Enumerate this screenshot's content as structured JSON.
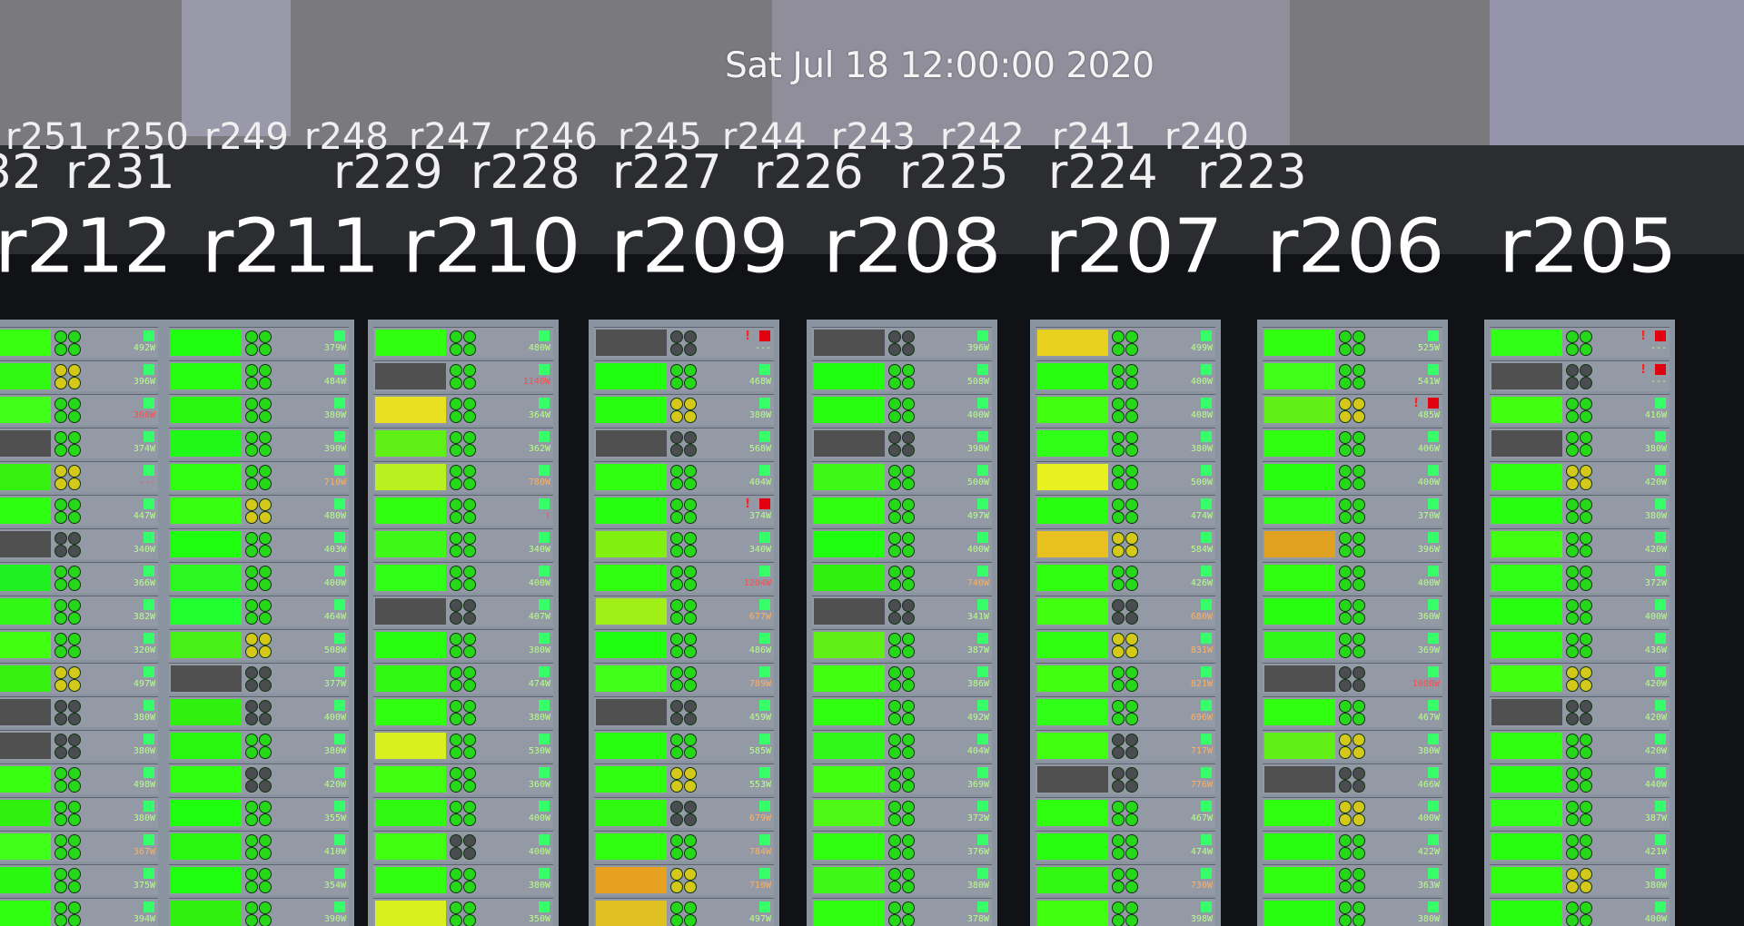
{
  "timestamp": "Sat Jul 18 12:00:00 2020",
  "far_row": [
    "r251",
    "r250",
    "r249",
    "r248",
    "r247",
    "r246",
    "r245",
    "r244",
    "r243",
    "r242",
    "r241",
    "r240"
  ],
  "mid_row": [
    "32",
    "r231",
    "r229",
    "r228",
    "r227",
    "r226",
    "r225",
    "r224",
    "r223"
  ],
  "near_row": [
    "r212",
    "r211",
    "r210",
    "r209",
    "r208",
    "r207",
    "r206",
    "r205"
  ],
  "colors": {
    "led_on": "#27d81a",
    "led_warn": "#d4c81a",
    "led_off": "#4a4c50",
    "alert": "#e00010"
  },
  "racks": [
    {
      "label": "r212",
      "nodes": [
        {
          "p": "492W",
          "h": "#38ff10",
          "s": "on"
        },
        {
          "p": "396W",
          "h": "#30f810",
          "s": "warn"
        },
        {
          "p": "300W",
          "h": "#40ff18",
          "s": "on",
          "c": "hot"
        },
        {
          "p": "374W",
          "h": "#505050",
          "s": "on"
        },
        {
          "p": "---",
          "h": "#36f010",
          "s": "warn",
          "c": "hot"
        },
        {
          "p": "447W",
          "h": "#2cff10",
          "s": "on"
        },
        {
          "p": "340W",
          "h": "#505050",
          "s": "off"
        },
        {
          "p": "366W",
          "h": "#20f020",
          "s": "on"
        },
        {
          "p": "382W",
          "h": "#30f814",
          "s": "on"
        },
        {
          "p": "320W",
          "h": "#40ff10",
          "s": "on"
        },
        {
          "p": "497W",
          "h": "#36f010",
          "s": "warn"
        },
        {
          "p": "380W",
          "h": "#505050",
          "s": "off"
        },
        {
          "p": "380W",
          "h": "#505050",
          "s": "off"
        },
        {
          "p": "498W",
          "h": "#38ff10",
          "s": "on"
        },
        {
          "p": "380W",
          "h": "#30f010",
          "s": "on"
        },
        {
          "p": "367W",
          "h": "#40ff18",
          "s": "on",
          "c": "warm"
        },
        {
          "p": "375W",
          "h": "#28f810",
          "s": "on"
        },
        {
          "p": "394W",
          "h": "#30ff10",
          "s": "on"
        }
      ]
    },
    {
      "label": "r211",
      "nodes": [
        {
          "p": "379W",
          "h": "#20ff10",
          "s": "on"
        },
        {
          "p": "484W",
          "h": "#26ff10",
          "s": "on"
        },
        {
          "p": "380W",
          "h": "#28f810",
          "s": "on"
        },
        {
          "p": "390W",
          "h": "#20f818",
          "s": "on"
        },
        {
          "p": "710W",
          "h": "#30ff10",
          "s": "on",
          "c": "warm"
        },
        {
          "p": "480W",
          "h": "#36ff10",
          "s": "warn"
        },
        {
          "p": "403W",
          "h": "#20ff10",
          "s": "on"
        },
        {
          "p": "400W",
          "h": "#2af820",
          "s": "on"
        },
        {
          "p": "464W",
          "h": "#20ff30",
          "s": "on"
        },
        {
          "p": "508W",
          "h": "#48f018",
          "s": "warn"
        },
        {
          "p": "377W",
          "h": "#505050",
          "s": "off"
        },
        {
          "p": "400W",
          "h": "#30f010",
          "s": "off"
        },
        {
          "p": "380W",
          "h": "#28f810",
          "s": "on"
        },
        {
          "p": "420W",
          "h": "#30ff10",
          "s": "off"
        },
        {
          "p": "355W",
          "h": "#20ff10",
          "s": "on"
        },
        {
          "p": "410W",
          "h": "#28f810",
          "s": "on"
        },
        {
          "p": "354W",
          "h": "#20ff10",
          "s": "on"
        },
        {
          "p": "390W",
          "h": "#30f010",
          "s": "on"
        }
      ]
    },
    {
      "label": "r210",
      "nodes": [
        {
          "p": "480W",
          "h": "#30ff10",
          "s": "on"
        },
        {
          "p": "1140W",
          "h": "#505050",
          "s": "on",
          "c": "hot"
        },
        {
          "p": "364W",
          "h": "#e8e020",
          "s": "on"
        },
        {
          "p": "362W",
          "h": "#60f018",
          "s": "on"
        },
        {
          "p": "780W",
          "h": "#b8f020",
          "s": "on",
          "c": "warm"
        },
        {
          "p": "!",
          "h": "#30ff10",
          "s": "on",
          "c": "hot"
        },
        {
          "p": "340W",
          "h": "#40f818",
          "s": "on"
        },
        {
          "p": "400W",
          "h": "#30ff18",
          "s": "on"
        },
        {
          "p": "407W",
          "h": "#505050",
          "s": "off"
        },
        {
          "p": "380W",
          "h": "#28ff10",
          "s": "on"
        },
        {
          "p": "474W",
          "h": "#30f810",
          "s": "on"
        },
        {
          "p": "380W",
          "h": "#30ff10",
          "s": "on"
        },
        {
          "p": "530W",
          "h": "#d8f020",
          "s": "on"
        },
        {
          "p": "360W",
          "h": "#40ff10",
          "s": "on"
        },
        {
          "p": "400W",
          "h": "#30f810",
          "s": "on"
        },
        {
          "p": "400W",
          "h": "#40ff10",
          "s": "off"
        },
        {
          "p": "380W",
          "h": "#30ff10",
          "s": "on"
        },
        {
          "p": "350W",
          "h": "#d8f020",
          "s": "on"
        }
      ]
    },
    {
      "label": "r209",
      "nodes": [
        {
          "p": "---",
          "h": "#505050",
          "s": "off",
          "alert": true
        },
        {
          "p": "468W",
          "h": "#20ff10",
          "s": "on"
        },
        {
          "p": "380W",
          "h": "#28ff10",
          "s": "warn"
        },
        {
          "p": "568W",
          "h": "#505050",
          "s": "off"
        },
        {
          "p": "404W",
          "h": "#30ff10",
          "s": "on"
        },
        {
          "p": "374W",
          "h": "#26ff10",
          "s": "on",
          "alert": true
        },
        {
          "p": "340W",
          "h": "#80f010",
          "s": "on"
        },
        {
          "p": "1204W",
          "h": "#30ff10",
          "s": "on",
          "c": "hot"
        },
        {
          "p": "677W",
          "h": "#a0f018",
          "s": "on",
          "c": "warm"
        },
        {
          "p": "486W",
          "h": "#20ff10",
          "s": "on"
        },
        {
          "p": "789W",
          "h": "#40ff18",
          "s": "on",
          "c": "warm"
        },
        {
          "p": "459W",
          "h": "#505050",
          "s": "off"
        },
        {
          "p": "585W",
          "h": "#28ff10",
          "s": "on"
        },
        {
          "p": "553W",
          "h": "#30ff10",
          "s": "warn"
        },
        {
          "p": "679W",
          "h": "#30f810",
          "s": "off",
          "c": "warm"
        },
        {
          "p": "784W",
          "h": "#30ff10",
          "s": "on",
          "c": "warm"
        },
        {
          "p": "710W",
          "h": "#e8a020",
          "s": "warn",
          "c": "warm"
        },
        {
          "p": "497W",
          "h": "#e0c020",
          "s": "on"
        }
      ]
    },
    {
      "label": "r208",
      "nodes": [
        {
          "p": "396W",
          "h": "#505050",
          "s": "off"
        },
        {
          "p": "508W",
          "h": "#20ff10",
          "s": "on"
        },
        {
          "p": "400W",
          "h": "#28ff10",
          "s": "on"
        },
        {
          "p": "398W",
          "h": "#505050",
          "s": "off"
        },
        {
          "p": "500W",
          "h": "#40f818",
          "s": "on"
        },
        {
          "p": "497W",
          "h": "#30ff10",
          "s": "on"
        },
        {
          "p": "400W",
          "h": "#20ff10",
          "s": "on"
        },
        {
          "p": "740W",
          "h": "#30f010",
          "s": "on",
          "c": "warm"
        },
        {
          "p": "341W",
          "h": "#505050",
          "s": "off"
        },
        {
          "p": "387W",
          "h": "#60f018",
          "s": "on"
        },
        {
          "p": "386W",
          "h": "#40ff10",
          "s": "on"
        },
        {
          "p": "492W",
          "h": "#30ff10",
          "s": "on"
        },
        {
          "p": "404W",
          "h": "#30f818",
          "s": "on"
        },
        {
          "p": "369W",
          "h": "#40ff10",
          "s": "on"
        },
        {
          "p": "372W",
          "h": "#50f818",
          "s": "on"
        },
        {
          "p": "376W",
          "h": "#30ff10",
          "s": "on"
        },
        {
          "p": "380W",
          "h": "#40f818",
          "s": "on"
        },
        {
          "p": "378W",
          "h": "#30ff10",
          "s": "on"
        }
      ]
    },
    {
      "label": "r207",
      "nodes": [
        {
          "p": "499W",
          "h": "#e8d020",
          "s": "on"
        },
        {
          "p": "400W",
          "h": "#28ff10",
          "s": "on"
        },
        {
          "p": "408W",
          "h": "#40ff10",
          "s": "on"
        },
        {
          "p": "380W",
          "h": "#30ff18",
          "s": "on"
        },
        {
          "p": "500W",
          "h": "#e8f020",
          "s": "on"
        },
        {
          "p": "474W",
          "h": "#28ff10",
          "s": "on"
        },
        {
          "p": "584W",
          "h": "#e8c020",
          "s": "warn"
        },
        {
          "p": "426W",
          "h": "#30ff10",
          "s": "on"
        },
        {
          "p": "680W",
          "h": "#40ff10",
          "s": "off",
          "c": "warm"
        },
        {
          "p": "831W",
          "h": "#30ff10",
          "s": "warn",
          "c": "warm"
        },
        {
          "p": "821W",
          "h": "#40ff10",
          "s": "on",
          "c": "warm"
        },
        {
          "p": "696W",
          "h": "#30ff18",
          "s": "on",
          "c": "warm"
        },
        {
          "p": "717W",
          "h": "#40ff10",
          "s": "off",
          "c": "warm"
        },
        {
          "p": "776W",
          "h": "#505050",
          "s": "off",
          "c": "warm"
        },
        {
          "p": "467W",
          "h": "#30ff10",
          "s": "on"
        },
        {
          "p": "474W",
          "h": "#28ff10",
          "s": "on"
        },
        {
          "p": "730W",
          "h": "#30f810",
          "s": "on",
          "c": "warm"
        },
        {
          "p": "398W",
          "h": "#40ff10",
          "s": "on"
        }
      ]
    },
    {
      "label": "r206",
      "nodes": [
        {
          "p": "525W",
          "h": "#30ff10",
          "s": "on"
        },
        {
          "p": "541W",
          "h": "#40ff18",
          "s": "on"
        },
        {
          "p": "485W",
          "h": "#60f018",
          "s": "warn",
          "alert": true
        },
        {
          "p": "406W",
          "h": "#30ff10",
          "s": "on"
        },
        {
          "p": "400W",
          "h": "#28ff10",
          "s": "on"
        },
        {
          "p": "370W",
          "h": "#30ff18",
          "s": "on"
        },
        {
          "p": "396W",
          "h": "#e0a020",
          "s": "on"
        },
        {
          "p": "400W",
          "h": "#30ff10",
          "s": "on"
        },
        {
          "p": "360W",
          "h": "#28ff10",
          "s": "on"
        },
        {
          "p": "369W",
          "h": "#30f818",
          "s": "on"
        },
        {
          "p": "1000W",
          "h": "#505050",
          "s": "off",
          "c": "hot"
        },
        {
          "p": "467W",
          "h": "#30ff10",
          "s": "on"
        },
        {
          "p": "380W",
          "h": "#60f018",
          "s": "warn"
        },
        {
          "p": "466W",
          "h": "#505050",
          "s": "off"
        },
        {
          "p": "400W",
          "h": "#30ff10",
          "s": "warn"
        },
        {
          "p": "422W",
          "h": "#28ff10",
          "s": "on"
        },
        {
          "p": "363W",
          "h": "#30ff10",
          "s": "on"
        },
        {
          "p": "380W",
          "h": "#28ff10",
          "s": "on"
        }
      ]
    },
    {
      "label": "r205",
      "nodes": [
        {
          "p": "---",
          "h": "#30ff18",
          "s": "on",
          "alert": true
        },
        {
          "p": "---",
          "h": "#505050",
          "s": "off",
          "alert": true
        },
        {
          "p": "416W",
          "h": "#40ff10",
          "s": "on"
        },
        {
          "p": "380W",
          "h": "#505050",
          "s": "on"
        },
        {
          "p": "420W",
          "h": "#30ff10",
          "s": "warn"
        },
        {
          "p": "380W",
          "h": "#28ff10",
          "s": "on"
        },
        {
          "p": "420W",
          "h": "#40ff10",
          "s": "on"
        },
        {
          "p": "372W",
          "h": "#30ff18",
          "s": "on"
        },
        {
          "p": "400W",
          "h": "#28ff10",
          "s": "on"
        },
        {
          "p": "436W",
          "h": "#30ff10",
          "s": "on"
        },
        {
          "p": "420W",
          "h": "#40ff10",
          "s": "warn"
        },
        {
          "p": "420W",
          "h": "#505050",
          "s": "off"
        },
        {
          "p": "420W",
          "h": "#30ff10",
          "s": "on"
        },
        {
          "p": "440W",
          "h": "#28ff10",
          "s": "on"
        },
        {
          "p": "387W",
          "h": "#30ff18",
          "s": "on"
        },
        {
          "p": "421W",
          "h": "#28ff10",
          "s": "on"
        },
        {
          "p": "380W",
          "h": "#30ff10",
          "s": "warn"
        },
        {
          "p": "400W",
          "h": "#28ff10",
          "s": "on"
        }
      ]
    }
  ]
}
